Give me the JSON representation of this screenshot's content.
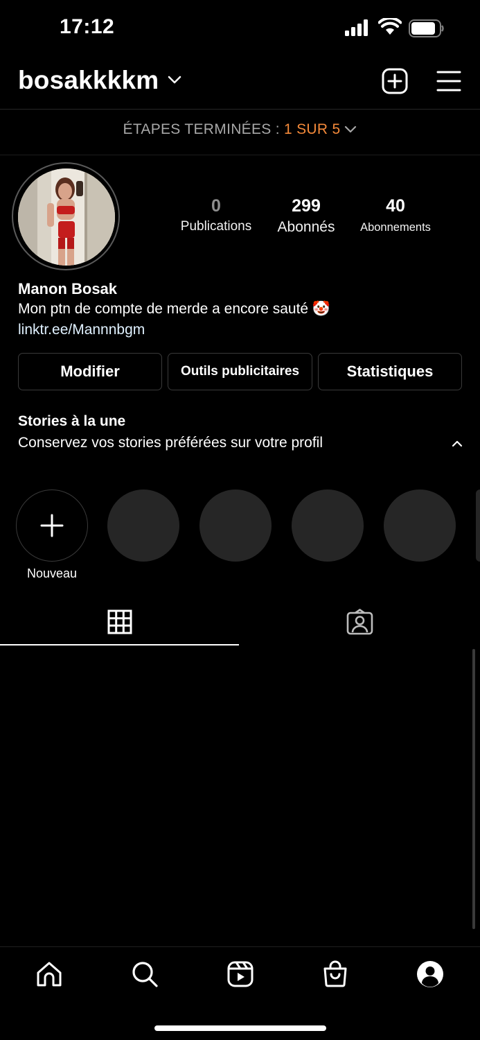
{
  "status_bar": {
    "time": "17:12"
  },
  "header": {
    "username": "bosakkkkm"
  },
  "steps": {
    "prefix": "ÉTAPES TERMINÉES : ",
    "progress": "1 SUR 5"
  },
  "profile": {
    "stats": [
      {
        "value": "0",
        "label": "Publications"
      },
      {
        "value": "299",
        "label": "Abonnés"
      },
      {
        "value": "40",
        "label": "Abonnements"
      }
    ],
    "full_name": "Manon Bosak",
    "bio": "Mon ptn de compte de merde a encore sauté 🤡",
    "link": "linktr.ee/Mannnbgm"
  },
  "actions": {
    "edit": "Modifier",
    "ad_tools": "Outils publicitaires",
    "stats": "Statistiques"
  },
  "highlights": {
    "title": "Stories à la une",
    "subtitle": "Conservez vos stories préférées sur votre profil",
    "new_label": "Nouveau"
  },
  "colors": {
    "accent": "#f58a3a",
    "link": "#e0f1ff",
    "placeholder": "#262626"
  },
  "tabs": [
    "grid-icon",
    "tagged-icon"
  ],
  "nav": [
    "home-icon",
    "search-icon",
    "reels-icon",
    "shop-icon",
    "profile-icon"
  ]
}
